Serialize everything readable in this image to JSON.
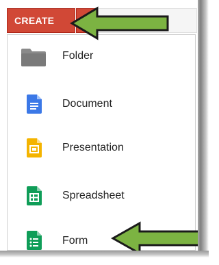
{
  "toolbar": {
    "create_label": "CREATE"
  },
  "menu": {
    "items": [
      {
        "label": "Folder",
        "icon": "folder-icon",
        "color": "#8a8a8a"
      },
      {
        "label": "Document",
        "icon": "document-icon",
        "color": "#3b78e7"
      },
      {
        "label": "Presentation",
        "icon": "presentation-icon",
        "color": "#f4b400"
      },
      {
        "label": "Spreadsheet",
        "icon": "spreadsheet-icon",
        "color": "#0f9d58"
      },
      {
        "label": "Form",
        "icon": "form-icon",
        "color": "#0f9d58"
      }
    ]
  },
  "colors": {
    "create_button": "#d14836",
    "annotation_arrow": "#7cb342"
  }
}
